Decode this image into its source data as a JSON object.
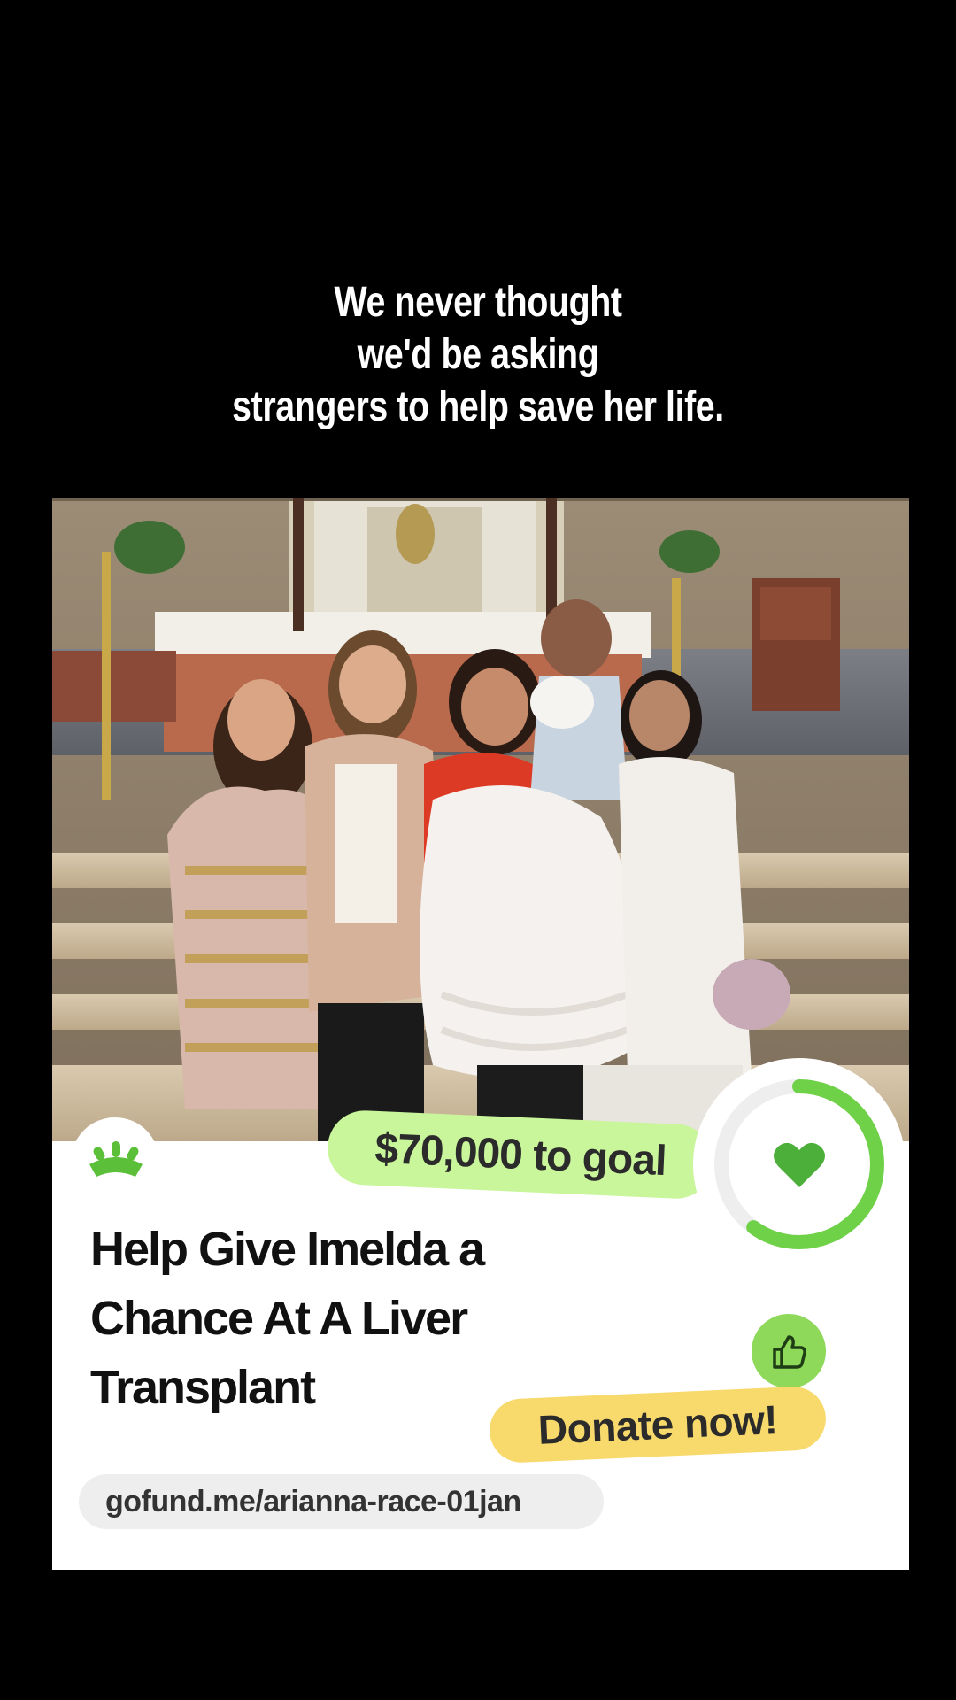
{
  "headline": {
    "line1": "We never thought",
    "line2": "we'd be asking",
    "line3": "strangers to help save her life."
  },
  "photo": {
    "alt": "family-at-baptism-photo"
  },
  "card": {
    "goal_label": "$70,000 to goal",
    "title": "Help Give Imelda a Chance At A Liver Transplant",
    "donate_label": "Donate now!",
    "url": "gofund.me/arianna-race-01jan",
    "progress_fraction": 0.6,
    "icons": {
      "logo": "gofundme-logo-icon",
      "progress_heart": "heart-icon",
      "thumb": "thumbs-up-icon"
    }
  },
  "colors": {
    "background": "#000000",
    "card": "#ffffff",
    "brand_green": "#5bbf3a",
    "goal_pill": "#c9f59b",
    "donate_pill": "#f8d96b",
    "url_pill": "#eeeeee"
  }
}
